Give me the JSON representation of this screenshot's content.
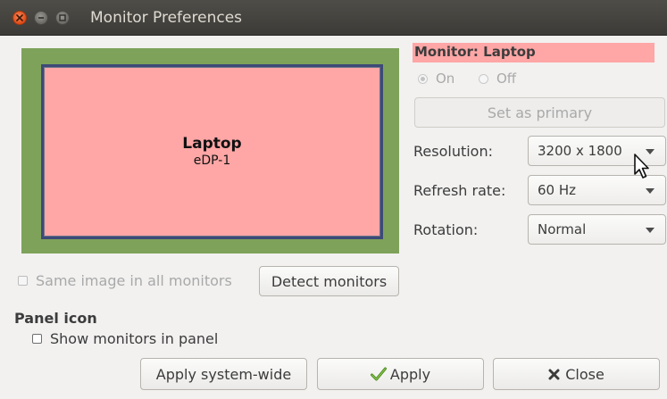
{
  "window": {
    "title": "Monitor Preferences"
  },
  "preview": {
    "monitor_name": "Laptop",
    "monitor_port": "eDP-1"
  },
  "options": {
    "same_image_label": "Same image in all monitors",
    "detect_label": "Detect monitors"
  },
  "panel": {
    "heading": "Panel icon",
    "show_label": "Show monitors in panel"
  },
  "buttons": {
    "apply_system_wide": "Apply system-wide",
    "apply": "Apply",
    "close": "Close"
  },
  "monitor": {
    "title": "Monitor: Laptop",
    "on_label": "On",
    "off_label": "Off",
    "primary_label": "Set as primary",
    "resolution_label": "Resolution:",
    "resolution_value": "3200 x 1800",
    "refresh_label": "Refresh rate:",
    "refresh_value": "60 Hz",
    "rotation_label": "Rotation:",
    "rotation_value": "Normal"
  },
  "colors": {
    "monitor_fill": "#ffa6a6",
    "monitor_frame": "#7ea25a",
    "monitor_border": "#3d4a77",
    "titlebar": "#3c3b37"
  },
  "icons": {
    "apply": "check-icon",
    "close": "x-icon"
  }
}
